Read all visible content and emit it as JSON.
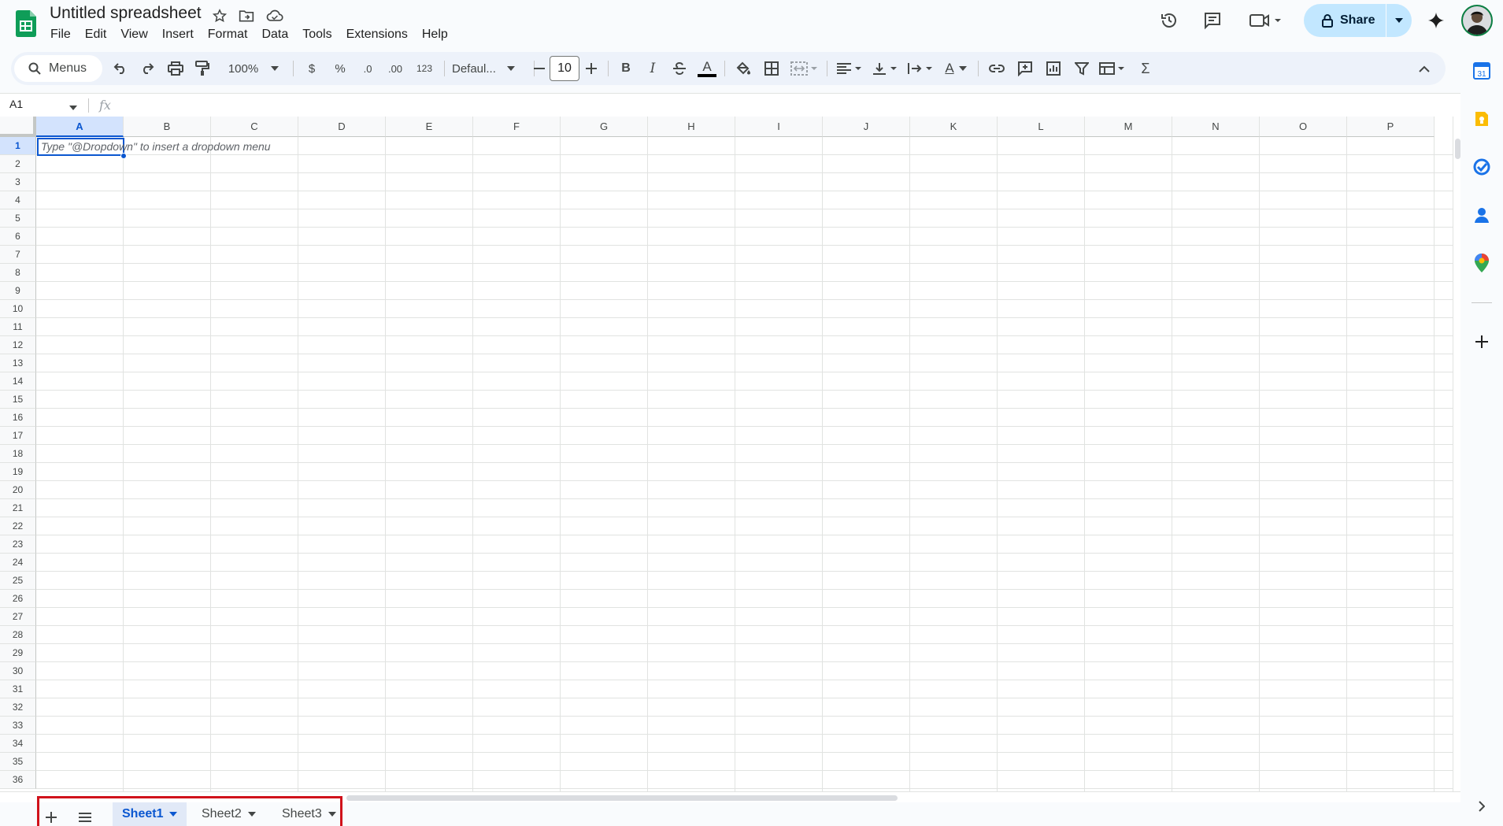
{
  "document": {
    "title": "Untitled spreadsheet",
    "menu": [
      "File",
      "Edit",
      "View",
      "Insert",
      "Format",
      "Data",
      "Tools",
      "Extensions",
      "Help"
    ]
  },
  "header": {
    "share_label": "Share"
  },
  "toolbar": {
    "menus_label": "Menus",
    "zoom": "100%",
    "currency": "$",
    "percent": "%",
    "decrease_decimal": ".0",
    "increase_decimal": ".00",
    "number_format": "123",
    "font_family": "Defaul...",
    "font_size": "10",
    "bold": "B",
    "italic": "I",
    "text_color_letter": "A",
    "text_rotate_letter": "A",
    "sum": "Σ"
  },
  "formula_bar": {
    "cell_ref": "A1",
    "fx": "fx"
  },
  "grid": {
    "columns": [
      "A",
      "B",
      "C",
      "D",
      "E",
      "F",
      "G",
      "H",
      "I",
      "J",
      "K",
      "L",
      "M",
      "N",
      "O",
      "P"
    ],
    "rows": [
      "1",
      "2",
      "3",
      "4",
      "5",
      "6",
      "7",
      "8",
      "9",
      "10",
      "11",
      "12",
      "13",
      "14",
      "15",
      "16",
      "17",
      "18",
      "19",
      "20",
      "21",
      "22",
      "23",
      "24",
      "25",
      "26",
      "27",
      "28",
      "29",
      "30",
      "31",
      "32",
      "33",
      "34",
      "35",
      "36"
    ],
    "selected_column": "A",
    "selected_row": "1",
    "hint_text": "Type \"@Dropdown\"  to insert a dropdown menu"
  },
  "sheets": {
    "tabs": [
      {
        "label": "Sheet1",
        "active": true
      },
      {
        "label": "Sheet2",
        "active": false
      },
      {
        "label": "Sheet3",
        "active": false
      }
    ]
  },
  "side_panel": {
    "calendar_day": "31"
  },
  "colors": {
    "accent": "#0b57d0",
    "share_bg": "#c2e7ff",
    "highlight_border": "#d0121b",
    "sheets_green": "#0f9d58"
  }
}
